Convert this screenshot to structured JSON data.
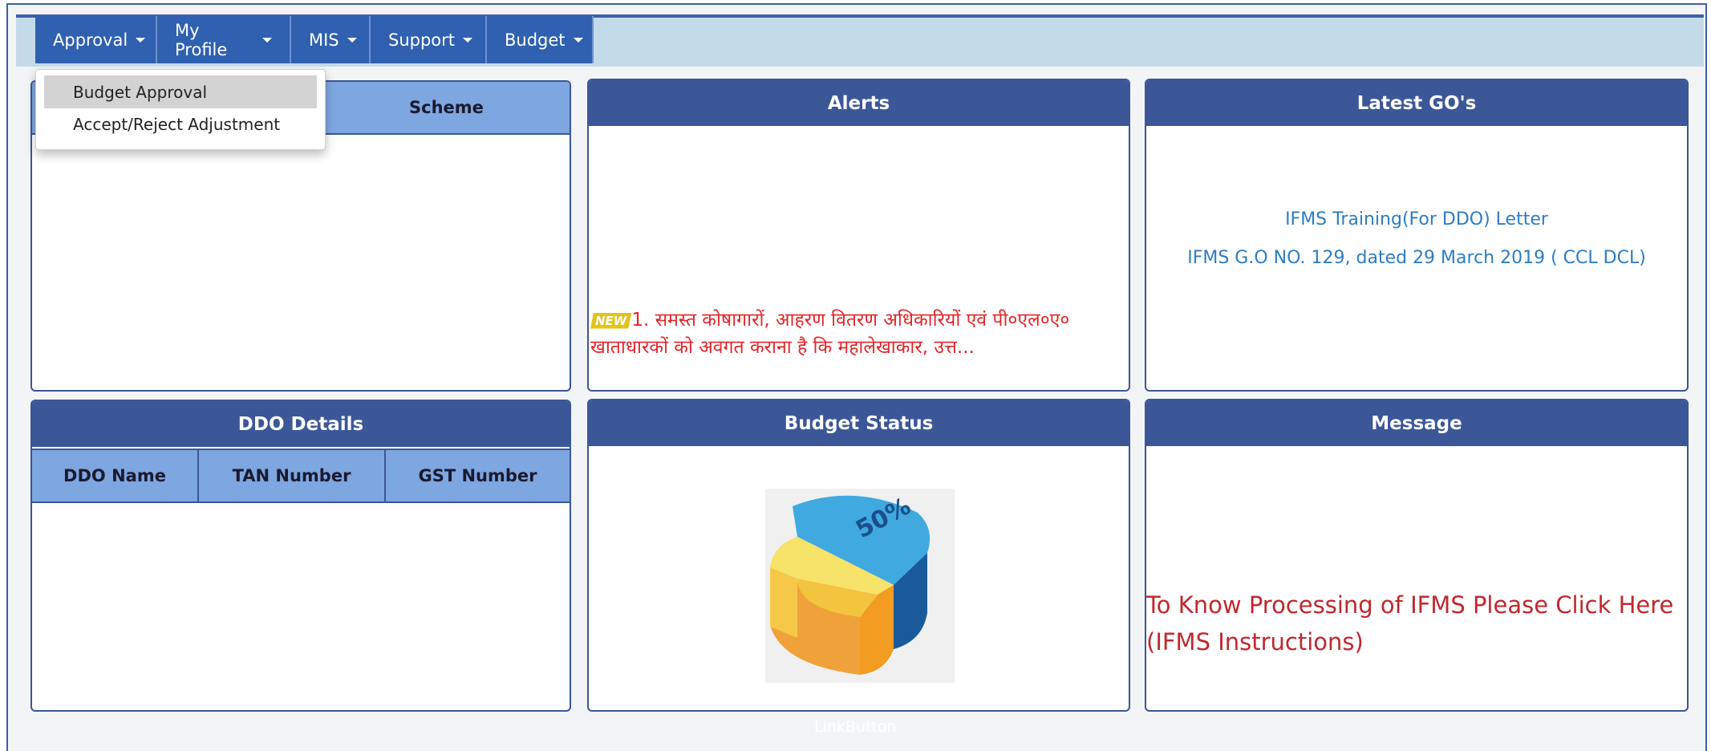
{
  "nav": {
    "items": [
      "Approval",
      "My Profile",
      "MIS",
      "Support",
      "Budget"
    ]
  },
  "dropdown": {
    "items": [
      "Budget Approval",
      "Accept/Reject Adjustment"
    ]
  },
  "scheme_panel": {
    "column": "Scheme"
  },
  "alerts": {
    "title": "Alerts",
    "badge": "NEW",
    "text": "1. समस्त कोषागारों, आहरण वितरण अधिकारियों एवं पी०एल०ए० खाताधारकों को अवगत कराना है कि महालेखाकार, उत्त..."
  },
  "latest_go": {
    "title": "Latest GO's",
    "links": [
      "IFMS Training(For DDO) Letter",
      "IFMS G.O NO. 129, dated 29 March 2019 ( CCL DCL)"
    ]
  },
  "ddo": {
    "title": "DDO Details",
    "columns": [
      "DDO Name",
      "TAN Number",
      "GST Number"
    ]
  },
  "budget_status": {
    "title": "Budget Status",
    "pie_label": "50%"
  },
  "message": {
    "title": "Message",
    "text": "To Know Processing of IFMS Please Click Here (IFMS Instructions)"
  },
  "footer": {
    "link_button": "LinkButton"
  },
  "colors": {
    "nav_blue": "#3060b0",
    "panel_header": "#3b5797",
    "table_header": "#7ea6e0",
    "alert_red": "#e2262b",
    "link_blue": "#2d7dc2",
    "message_red": "#c0282e"
  }
}
